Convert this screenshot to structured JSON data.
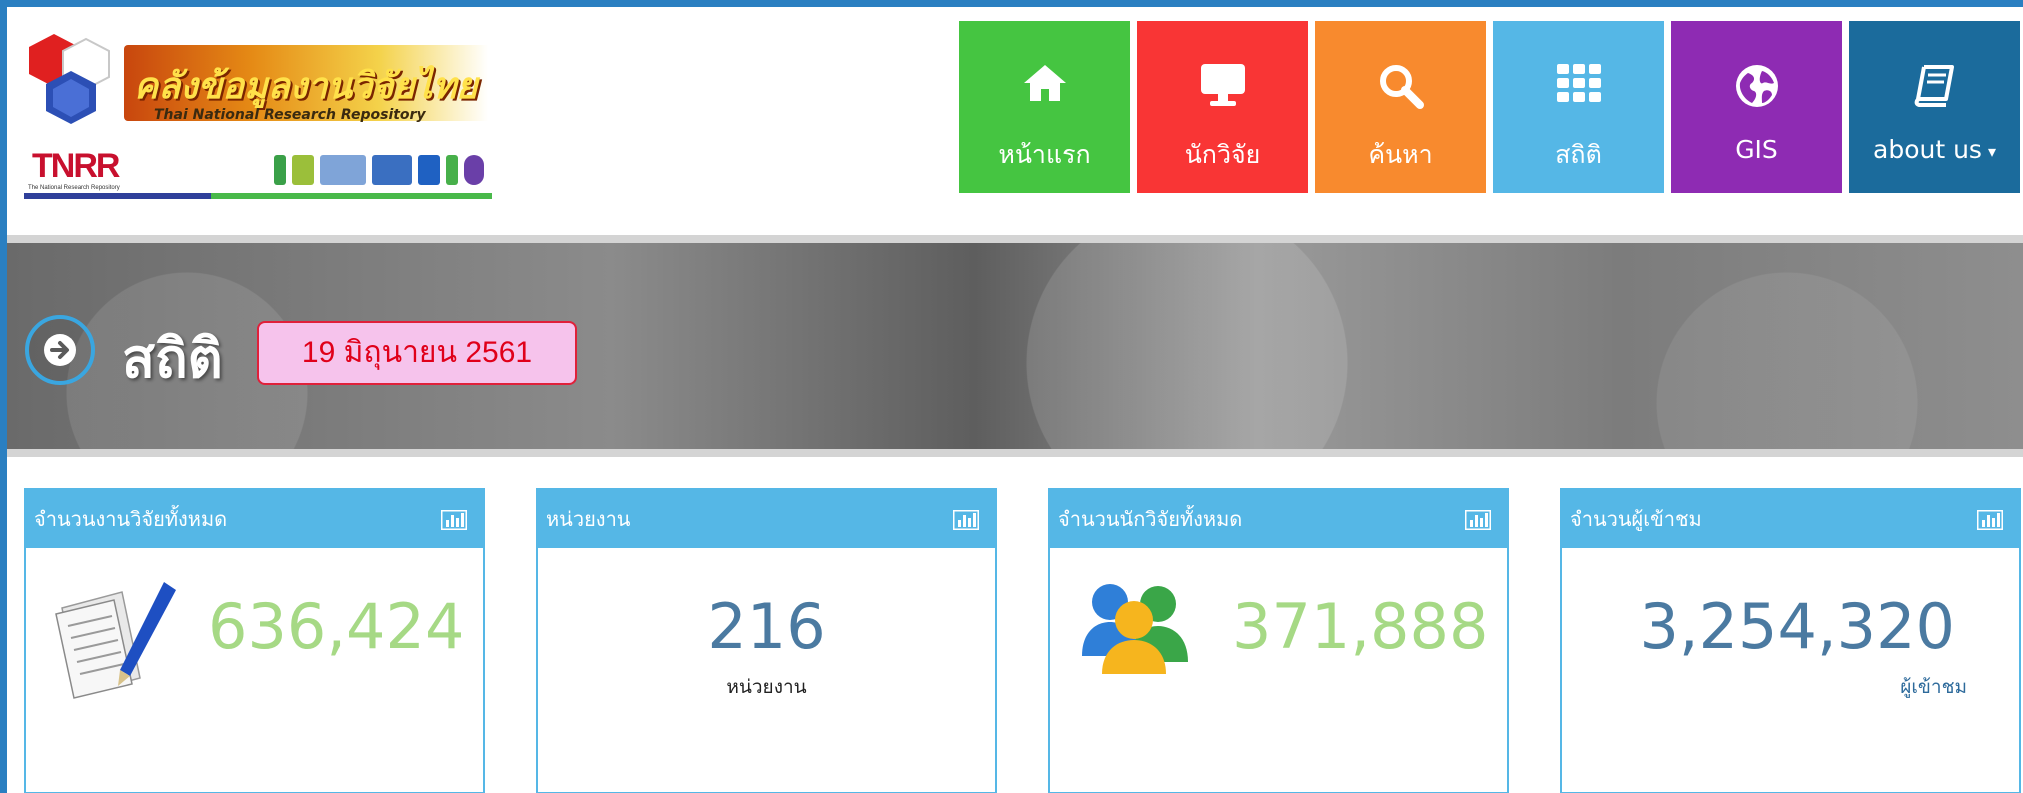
{
  "logo": {
    "title_th": "คลังข้อมูลงานวิจัยไทย",
    "title_en": "Thai National Research Repository",
    "abbr": "TNRR",
    "abbr_sub": "The National Research Repository"
  },
  "nav": {
    "items": [
      {
        "label": "หน้าแรก",
        "icon": "home-icon",
        "color": "#45c541"
      },
      {
        "label": "นักวิจัย",
        "icon": "monitor-icon",
        "color": "#f93535"
      },
      {
        "label": "ค้นหา",
        "icon": "search-icon",
        "color": "#f88a2e"
      },
      {
        "label": "สถิติ",
        "icon": "grid-icon",
        "color": "#55b7e6"
      },
      {
        "label": "GIS",
        "icon": "globe-icon",
        "color": "#8e2bb3"
      },
      {
        "label": "about us",
        "icon": "book-icon",
        "color": "#1b6b9c"
      }
    ]
  },
  "hero": {
    "title": "สถิติ",
    "date": "19 มิถุนายน 2561",
    "icon": "arrow-right-circle-icon"
  },
  "cards": [
    {
      "title": "จำนวนงานวิจัยทั้งหมด",
      "value": "636,424",
      "icon": "document-pen-icon"
    },
    {
      "title": "หน่วยงาน",
      "value": "216",
      "sub": "หน่วยงาน"
    },
    {
      "title": "จำนวนนักวิจัยทั้งหมด",
      "value": "371,888",
      "icon": "people-icon"
    },
    {
      "title": "จำนวนผู้เข้าชม",
      "value": "3,254,320",
      "sub": "ผู้เข้าชม"
    }
  ],
  "colors": {
    "accent": "#55b7e6",
    "value_green": "#a6d985",
    "value_blue": "#4b7aa1",
    "frame": "#2a7fc1"
  }
}
